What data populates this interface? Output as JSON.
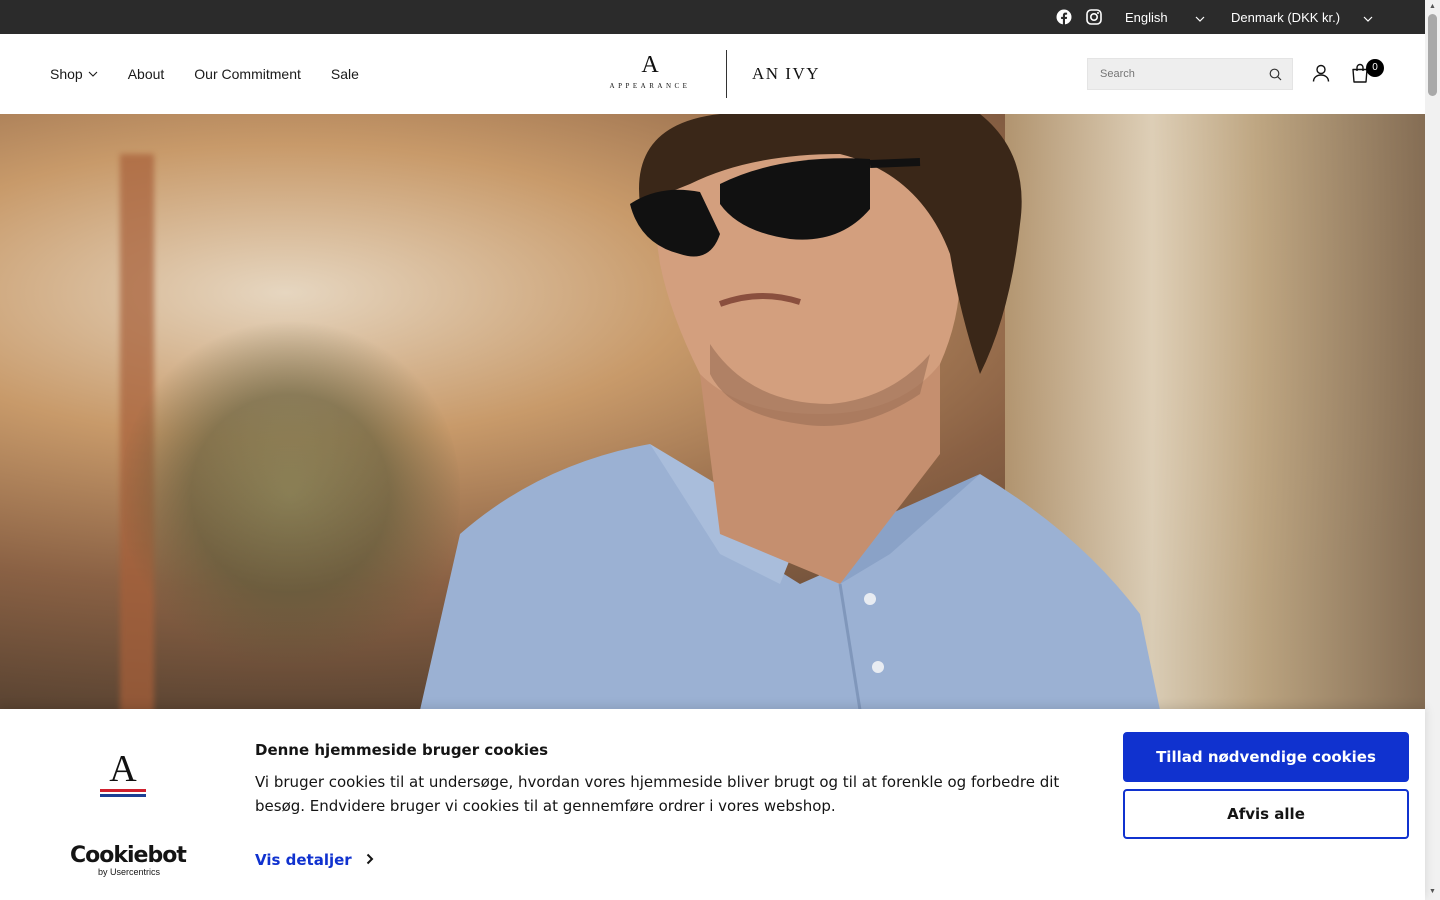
{
  "topbar": {
    "social": [
      {
        "icon": "facebook-icon"
      },
      {
        "icon": "instagram-icon"
      }
    ],
    "language": "English",
    "country": "Denmark (DKK kr.)"
  },
  "header": {
    "nav": [
      {
        "label": "Shop",
        "has_dropdown": true
      },
      {
        "label": "About"
      },
      {
        "label": "Our Commitment"
      },
      {
        "label": "Sale"
      }
    ],
    "logo_primary": {
      "letter": "A",
      "word": "APPEARANCE"
    },
    "logo_secondary": "AN IVY",
    "search": {
      "placeholder": "Search",
      "value": ""
    },
    "cart_count": "0"
  },
  "hero": {
    "image": "man-in-sunglasses-light-blue-polo"
  },
  "cookie": {
    "title": "Denne hjemmeside bruger cookies",
    "text": "Vi bruger cookies til at undersøge, hvordan vores hjemmeside bliver brugt og til at forenkle og forbedre dit besøg. Endvidere bruger vi cookies til at gennemføre ordrer i vores webshop.",
    "details_label": "Vis detaljer",
    "allow_label": "Tillad nødvendige cookies",
    "deny_label": "Afvis alle",
    "brand_letter": "A",
    "cookiebot": "Cookiebot",
    "cookiebot_by": "by Usercentrics"
  },
  "colors": {
    "accent": "#1032cf",
    "topbar": "#2b2b2b",
    "stripe_red": "#d0202e",
    "stripe_blue": "#1c3f94"
  }
}
